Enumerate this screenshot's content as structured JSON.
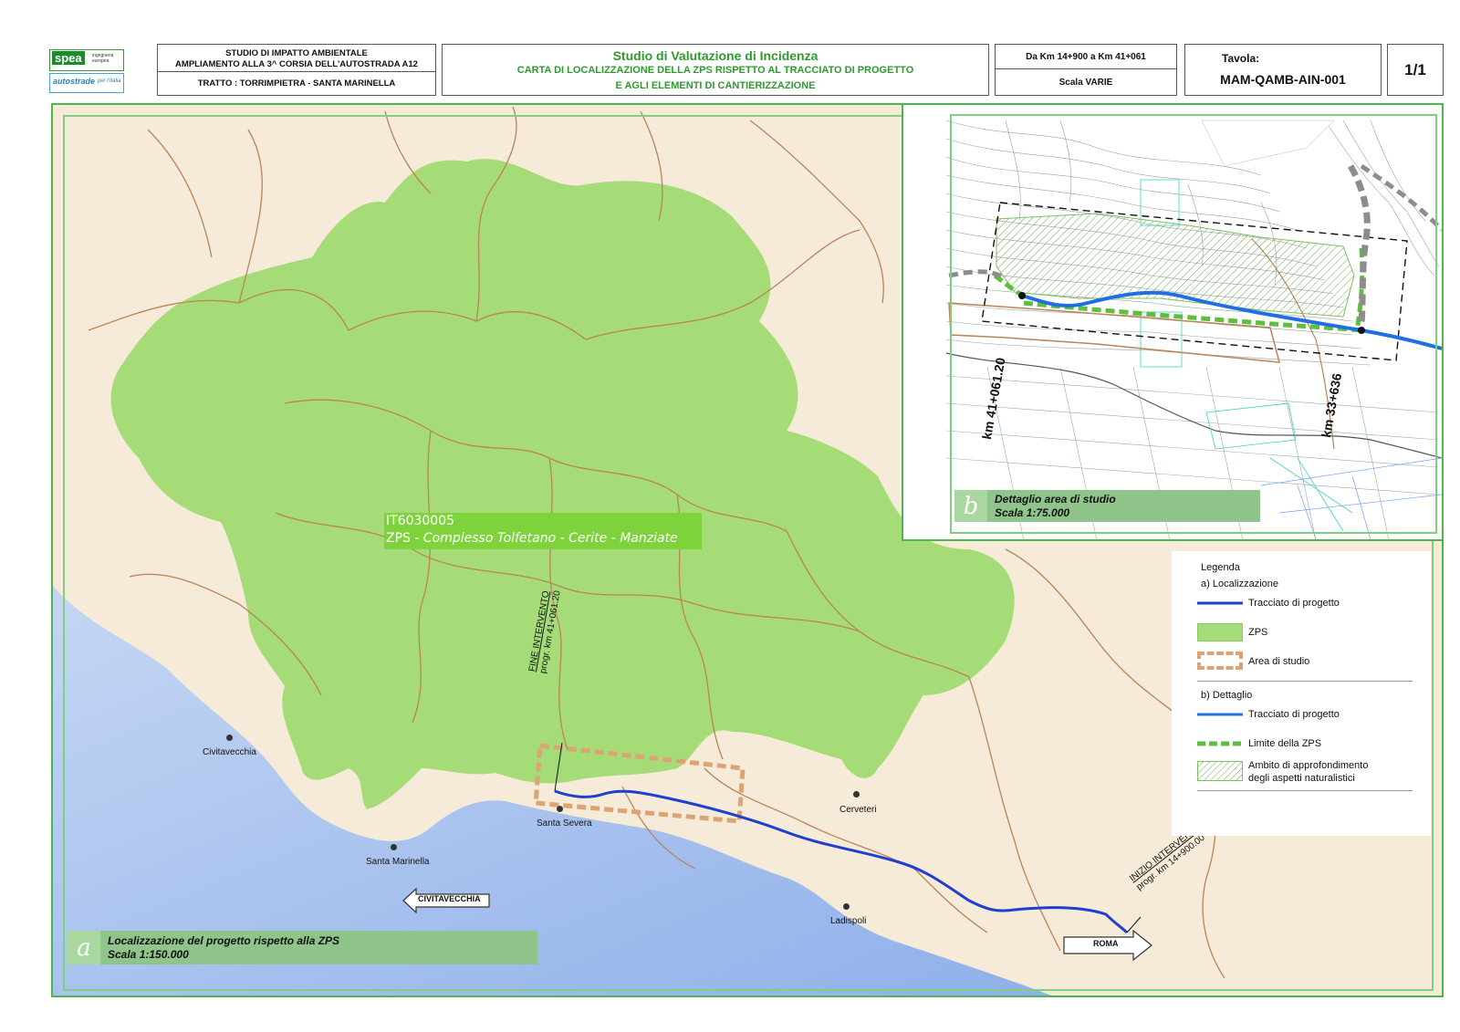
{
  "header": {
    "logo_spea": "spea",
    "logo_spea_sub": "ingegneria europea",
    "logo_autostrade": "autostrade",
    "logo_autostrade_sub": "per l'Italia",
    "study_line1": "STUDIO DI IMPATTO AMBIENTALE",
    "study_line2": "AMPLIAMENTO ALLA 3^ CORSIA DELL'AUTOSTRADA A12",
    "tratto": "TRATTO : TORRIMPIETRA - SANTA MARINELLA",
    "title_main": "Studio di Valutazione di Incidenza",
    "title_sub1": "CARTA DI LOCALIZZAZIONE DELLA ZPS RISPETTO AL TRACCIATO DI PROGETTO",
    "title_sub2": "E AGLI ELEMENTI DI CANTIERIZZAZIONE",
    "km_range": "Da Km 14+900 a Km 41+061",
    "scala": "Scala VARIE",
    "tavola_label": "Tavola:",
    "tavola_code": "MAM-QAMB-AIN-001",
    "sheet": "1/1"
  },
  "map_a": {
    "zps_code": "IT6030005",
    "zps_name_prefix": "ZPS - ",
    "zps_name": "Complesso Tolfetano - Cerite - Manziate",
    "fine_line1": "FINE INTERVENTO",
    "fine_line2": "progr. km 41+061.20",
    "inizio_line1": "INIZIO INTERVENTO",
    "inizio_line2": "progr. km 14+900.00",
    "arrow_left": "CIVITAVECCHIA",
    "arrow_right": "ROMA",
    "towns": [
      "Civitavecchia",
      "Santa Marinella",
      "Santa Severa",
      "Cerveteri",
      "Ladispoli"
    ],
    "caption_letter": "a",
    "caption_line1": "Localizzazione del progetto rispetto alla ZPS",
    "caption_line2": "Scala 1:150.000"
  },
  "map_b": {
    "km_left": "km 41+061.20",
    "km_right": "km 33+636",
    "caption_letter": "b",
    "caption_line1": "Dettaglio area di studio",
    "caption_line2": "Scala 1:75.000"
  },
  "legend": {
    "title": "Legenda",
    "section_a": "a) Localizzazione",
    "a_items": [
      "Tracciato di progetto",
      "ZPS",
      "Area di studio"
    ],
    "section_b": "b) Dettaglio",
    "b_items": [
      "Tracciato di progetto",
      "Limite della ZPS"
    ],
    "b_hatch_line1": "Ambito di approfondimento",
    "b_hatch_line2": "degli aspetti naturalistici"
  },
  "colors": {
    "zps_fill": "#a5dc78",
    "land": "#f6ead8",
    "sea": "#a9c3ee",
    "route": "#1f3fd0",
    "boundary": "#b88458",
    "frame": "#5fc35f"
  }
}
